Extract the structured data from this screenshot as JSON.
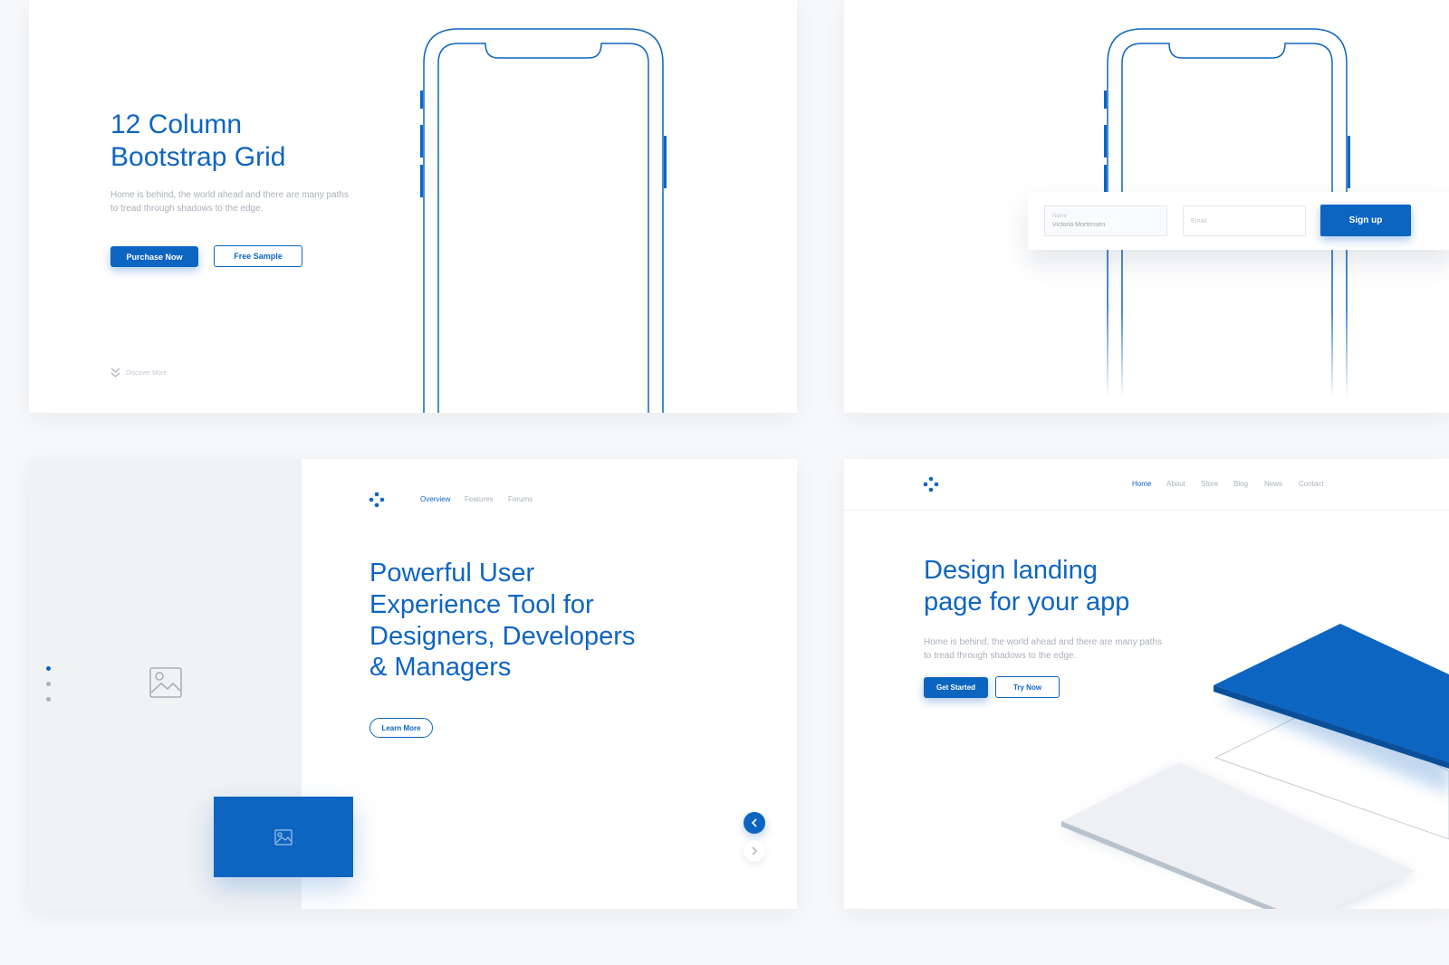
{
  "colors": {
    "accent": "#0d65c2",
    "muted": "#a9b0ba",
    "placeholder_bg": "#f0f2f4"
  },
  "card1": {
    "title_lines": [
      "12 Column",
      "Bootstrap Grid"
    ],
    "desc_lines": [
      "Home is behind, the world ahead and there are many paths",
      "to tread through shadows to the edge."
    ],
    "primary_button": "Purchase Now",
    "secondary_button": "Free Sample",
    "discover": "Discover More"
  },
  "card2": {
    "name_label": "Name",
    "name_value": "Victoria Mortensen",
    "email_placeholder": "Email",
    "signup_button": "Sign up"
  },
  "card3": {
    "nav": [
      "Overview",
      "Features",
      "Forums"
    ],
    "title_lines": [
      "Powerful User",
      "Experience Tool for",
      "Designers, Developers",
      "& Managers"
    ],
    "cta_button": "Learn More",
    "slider_dots_total": 3,
    "slider_active": 1
  },
  "card4": {
    "nav": [
      "Home",
      "About",
      "Store",
      "Blog",
      "News",
      "Contact"
    ],
    "title_lines": [
      "Design landing",
      "page for your app"
    ],
    "desc_lines": [
      "Home is behind, the world ahead and there are many paths",
      "to tread through shadows to the edge."
    ],
    "primary_button": "Get Started",
    "secondary_button": "Try Now"
  }
}
